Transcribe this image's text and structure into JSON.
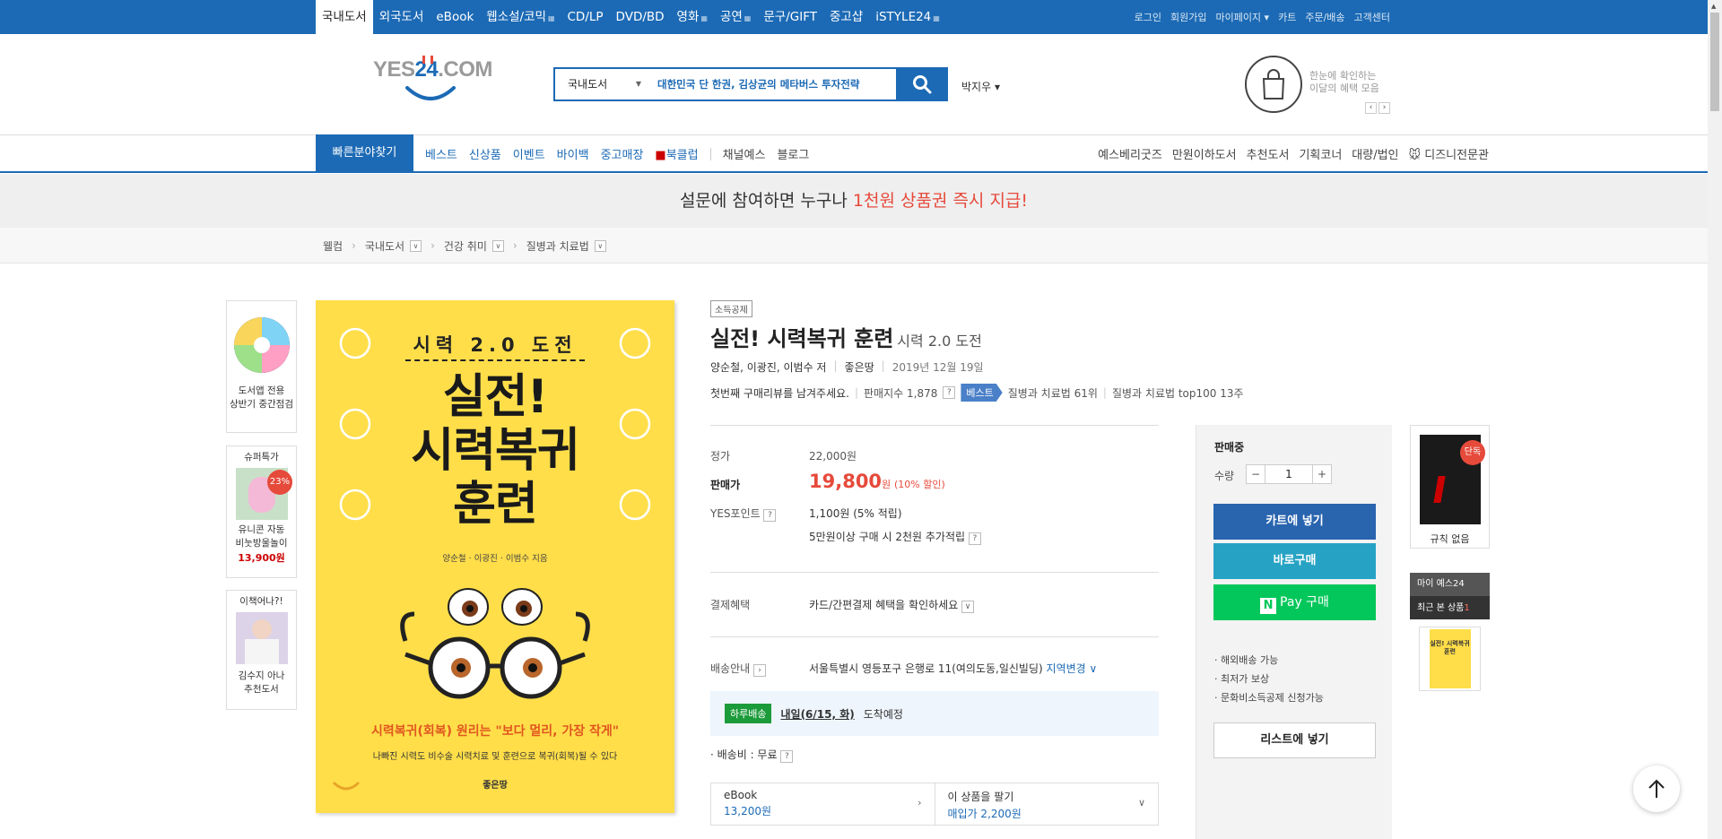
{
  "topnav": {
    "items": [
      {
        "label": "국내도서",
        "active": true,
        "more": false
      },
      {
        "label": "외국도서",
        "active": false,
        "more": false
      },
      {
        "label": "eBook",
        "active": false,
        "more": false
      },
      {
        "label": "웹소설/코믹",
        "active": false,
        "more": true
      },
      {
        "label": "CD/LP",
        "active": false,
        "more": false
      },
      {
        "label": "DVD/BD",
        "active": false,
        "more": false
      },
      {
        "label": "영화",
        "active": false,
        "more": true
      },
      {
        "label": "공연",
        "active": false,
        "more": true
      },
      {
        "label": "문구/GIFT",
        "active": false,
        "more": false
      },
      {
        "label": "중고샵",
        "active": false,
        "more": false
      },
      {
        "label": "iSTYLE24",
        "active": false,
        "more": true
      }
    ],
    "right": [
      "로그인",
      "회원가입",
      "마이페이지 ▾",
      "카트",
      "주문/배송",
      "고객센터"
    ]
  },
  "header": {
    "logo_main": "YES",
    "logo_num": "24",
    "logo_tail": ".COM",
    "search_category": "국내도서",
    "search_value": "대한민국 단 한권, 김상균의 메타버스 투자전략",
    "user_name": "박지우",
    "promo_line1": "한눈에 확인하는",
    "promo_line2": "이달의 혜택 모음"
  },
  "subnav": {
    "quick": "빠른분야찾기",
    "left": [
      "베스트",
      "신상품",
      "이벤트",
      "바이백",
      "중고매장"
    ],
    "bookclub": "북클럽",
    "left_gray": [
      "채널예스",
      "블로그"
    ],
    "right": [
      "예스베리굿즈",
      "만원이하도서",
      "추천도서",
      "기획코너",
      "대량/법인",
      "디즈니전문관"
    ]
  },
  "banner": {
    "text": "설문에 참여하면 누구나 ",
    "highlight": "1천원 상품권 즉시 지급!"
  },
  "breadcrumb": [
    "웰컴",
    "국내도서",
    "건강 취미",
    "질병과 치료법"
  ],
  "left_side": {
    "box1": [
      "도서앱 전용",
      "상반기 중간점검"
    ],
    "box2_title": "슈퍼특가",
    "box2_badge": "23%",
    "box2_caption": [
      "유니콘 자동",
      "비눗방울놀이"
    ],
    "box2_price": "13,900원",
    "box3_title": "이책어나?!",
    "box3_caption": [
      "김수지 아나",
      "추천도서"
    ]
  },
  "cover": {
    "top": "시력 2.0 도전",
    "title_lines": [
      "실전!",
      "시력복귀",
      "훈련"
    ],
    "authors": "양순철 · 이광진 · 이범수 지음",
    "slogan": "시력복귀(회복) 원리는 \"보다 멀리, 가장 작게\"",
    "subtitle": "나빠진 시력도 비수술 시력치료 및 훈련으로 복귀(회복)될 수 있다",
    "publisher": "좋은땅"
  },
  "product": {
    "tag": "소득공제",
    "title": "실전! 시력복귀 훈련",
    "subtitle": "시력 2.0 도전",
    "authors": "양순철, 이광진, 이범수 저",
    "publisher": "좋은땅",
    "date": "2019년 12월 19일",
    "review": "첫번째 구매리뷰를 남겨주세요.",
    "sales_index": "판매지수 1,878",
    "best_badge": "베스트",
    "rank1": "질병과 치료법 61위",
    "rank2": "질병과 치료법 top100 13주",
    "list_label": "정가",
    "list_price": "22,000원",
    "sale_label": "판매가",
    "sale_price": "19,800",
    "sale_unit": "원",
    "sale_pct": "(10% 할인)",
    "point_label": "YES포인트",
    "point_value": "1,100원 (5% 적립)",
    "point_extra": "5만원이상 구매 시 2천원 추가적립",
    "pay_label": "결제혜택",
    "pay_value": "카드/간편결제 혜택을 확인하세요",
    "ship_label": "배송안내",
    "ship_value": "서울특별시 영등포구 은행로 11(여의도동,일신빌딩)",
    "ship_change": "지역변경",
    "delivery_badge": "하루배송",
    "delivery_date": "내일(6/15, 화)",
    "delivery_suffix": "도착예정",
    "ship_fee": "· 배송비 : 무료",
    "ebook_label": "eBook",
    "ebook_price": "13,200원",
    "sell_label": "이 상품을 팔기",
    "sell_price": "매입가 2,200원"
  },
  "buy": {
    "status": "판매중",
    "qty_label": "수량",
    "qty": "1",
    "cart": "카트에 넣기",
    "buy_now": "바로구매",
    "npay": "Pay 구매",
    "notes": [
      "· 해외배송 가능",
      "· 최저가 보상",
      "· 문화비소득공제 신청가능"
    ],
    "list": "리스트에 넣기"
  },
  "right_side": {
    "badge": "단독",
    "caption": "규칙 없음",
    "my_title": "마이 예스24",
    "recent": "최근 본 상품",
    "recent_count": "1",
    "thumb_title": "실전! 시력복귀 훈련"
  },
  "colors": {
    "brand": "#1c6ab5",
    "sale": "#e64a3b",
    "npay": "#03c75a",
    "cover": "#ffde4a"
  }
}
